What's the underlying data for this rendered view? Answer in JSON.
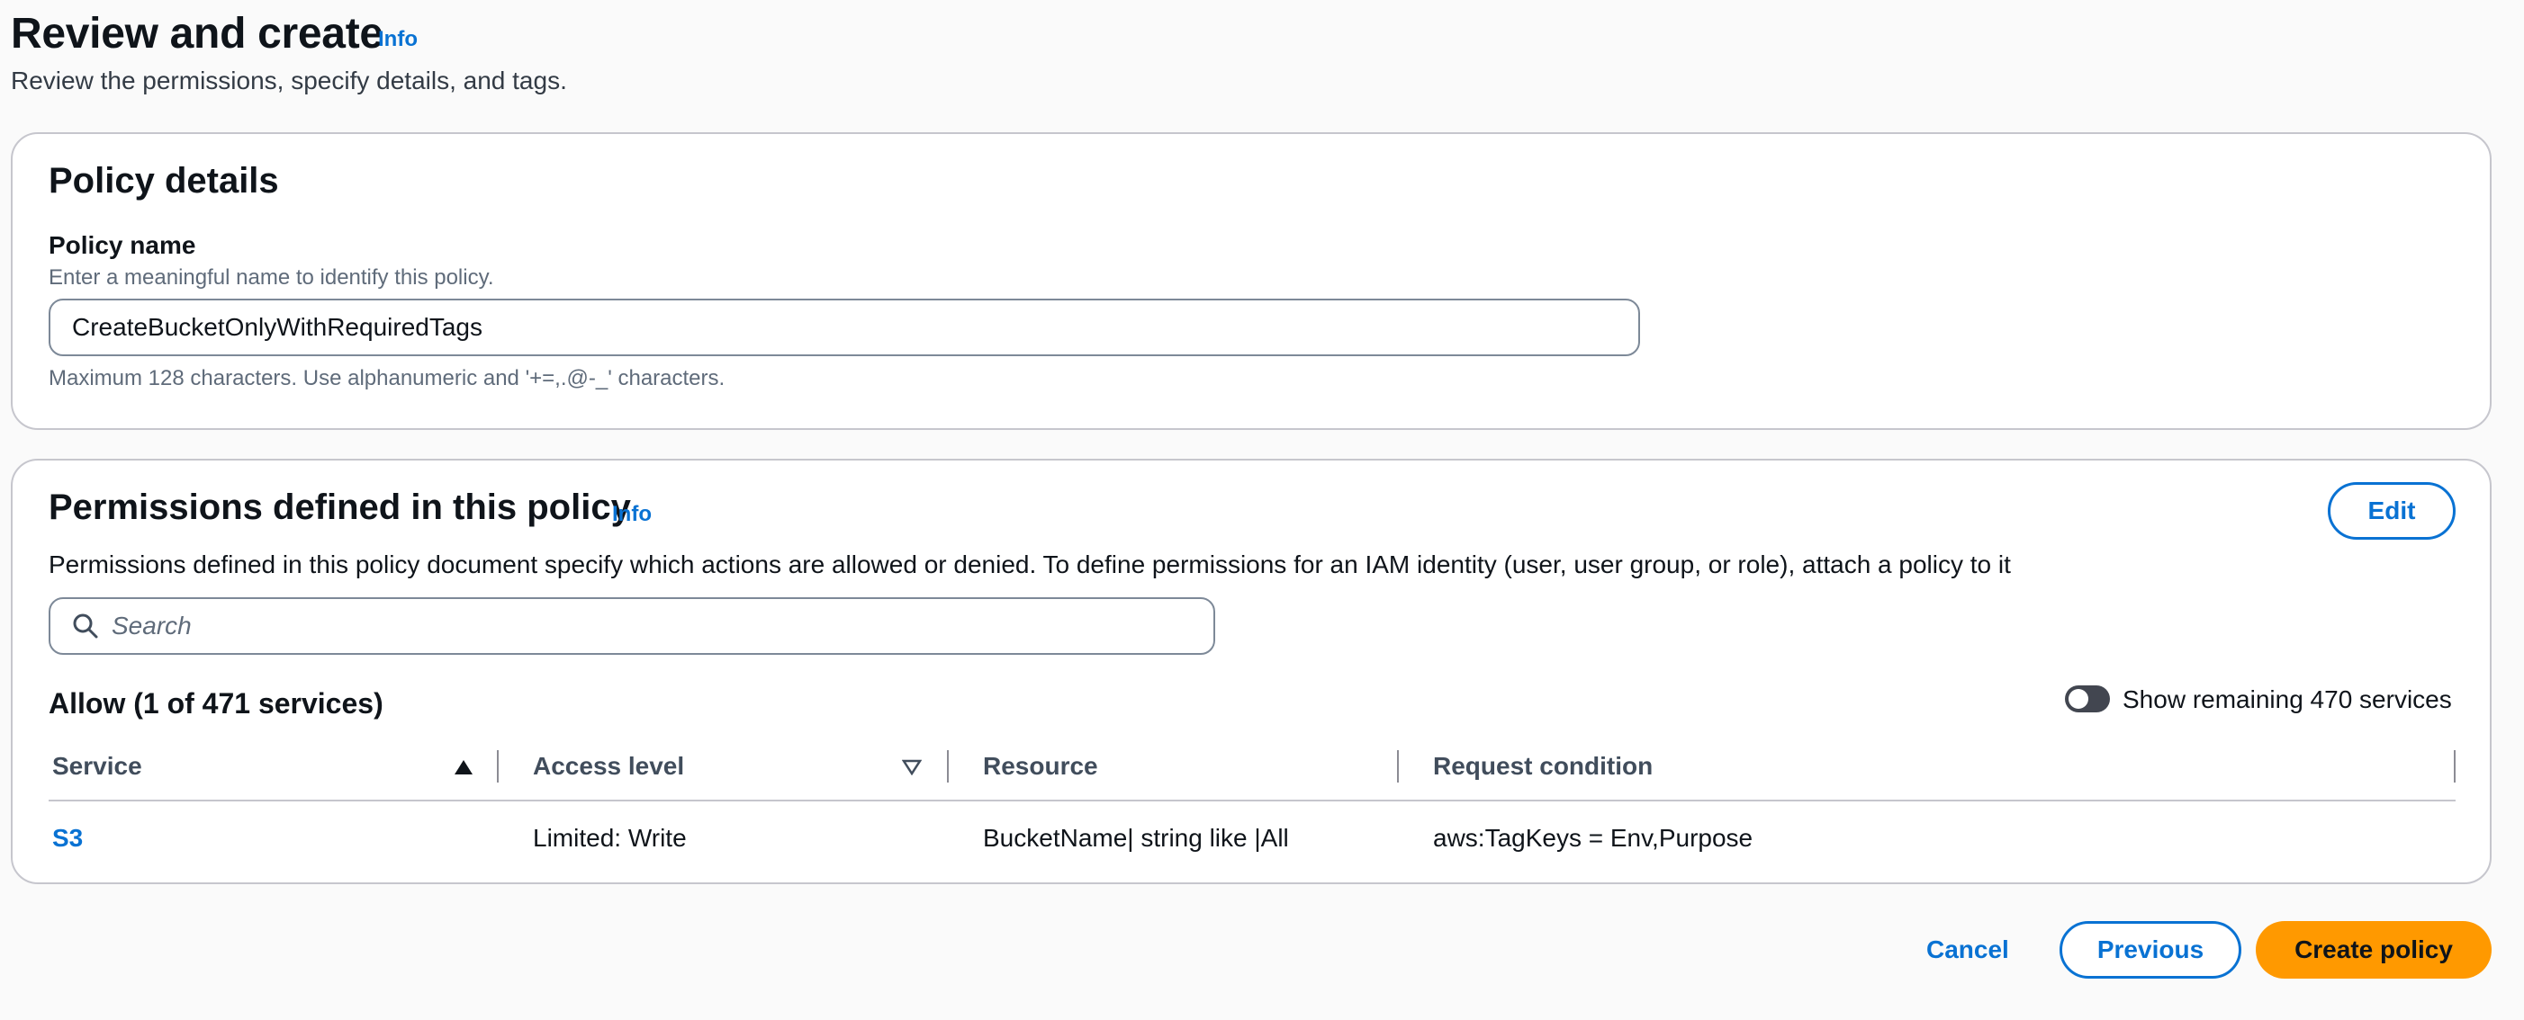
{
  "header": {
    "title": "Review and create",
    "info_label": "Info",
    "description": "Review the permissions, specify details, and tags."
  },
  "policy_details": {
    "title": "Policy details",
    "name_label": "Policy name",
    "name_description": "Enter a meaningful name to identify this policy.",
    "name_value": "CreateBucketOnlyWithRequiredTags",
    "name_constraint": "Maximum 128 characters. Use alphanumeric and '+=,.@-_' characters."
  },
  "permissions": {
    "title": "Permissions defined in this policy",
    "info_label": "Info",
    "edit_label": "Edit",
    "description": "Permissions defined in this policy document specify which actions are allowed or denied. To define permissions for an IAM identity (user, user group, or role), attach a policy to it",
    "search_placeholder": "Search",
    "allow_heading": "Allow (1 of 471 services)",
    "toggle_label": "Show remaining 470 services",
    "toggle_on": false,
    "columns": [
      "Service",
      "Access level",
      "Resource",
      "Request condition"
    ],
    "rows": [
      {
        "service": "S3",
        "access_level": "Limited: Write",
        "resource": "BucketName| string like |All",
        "request_condition": "aws:TagKeys = Env,Purpose"
      }
    ]
  },
  "footer": {
    "cancel_label": "Cancel",
    "previous_label": "Previous",
    "create_label": "Create policy"
  },
  "colors": {
    "link": "#0972d3",
    "primary_button": "#ff9900",
    "page_background": "#fafafa"
  }
}
